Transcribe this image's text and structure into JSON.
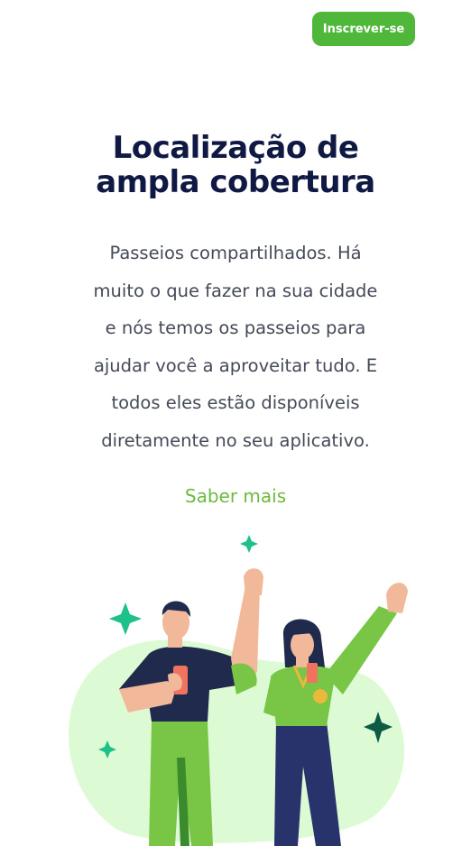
{
  "header": {
    "signup_label": "Inscrever-se"
  },
  "hero": {
    "title_lines": [
      "Localização de",
      "ampla cobertura"
    ],
    "description_lines": [
      "Passeios compartilhados. Há",
      "muito o que fazer na sua cidade",
      "e nós temos os passeios para",
      "ajudar você a aproveitar tudo. E",
      "todos eles estão disponíveis",
      "diretamente no seu aplicativo."
    ],
    "learn_more_label": "Saber mais"
  },
  "colors": {
    "accent": "#4fb83a",
    "title": "#0f1943",
    "body_text": "#454a58",
    "link": "#6cba3e",
    "blob": "#dcfbd5",
    "sparkle": "#1fc18a"
  }
}
